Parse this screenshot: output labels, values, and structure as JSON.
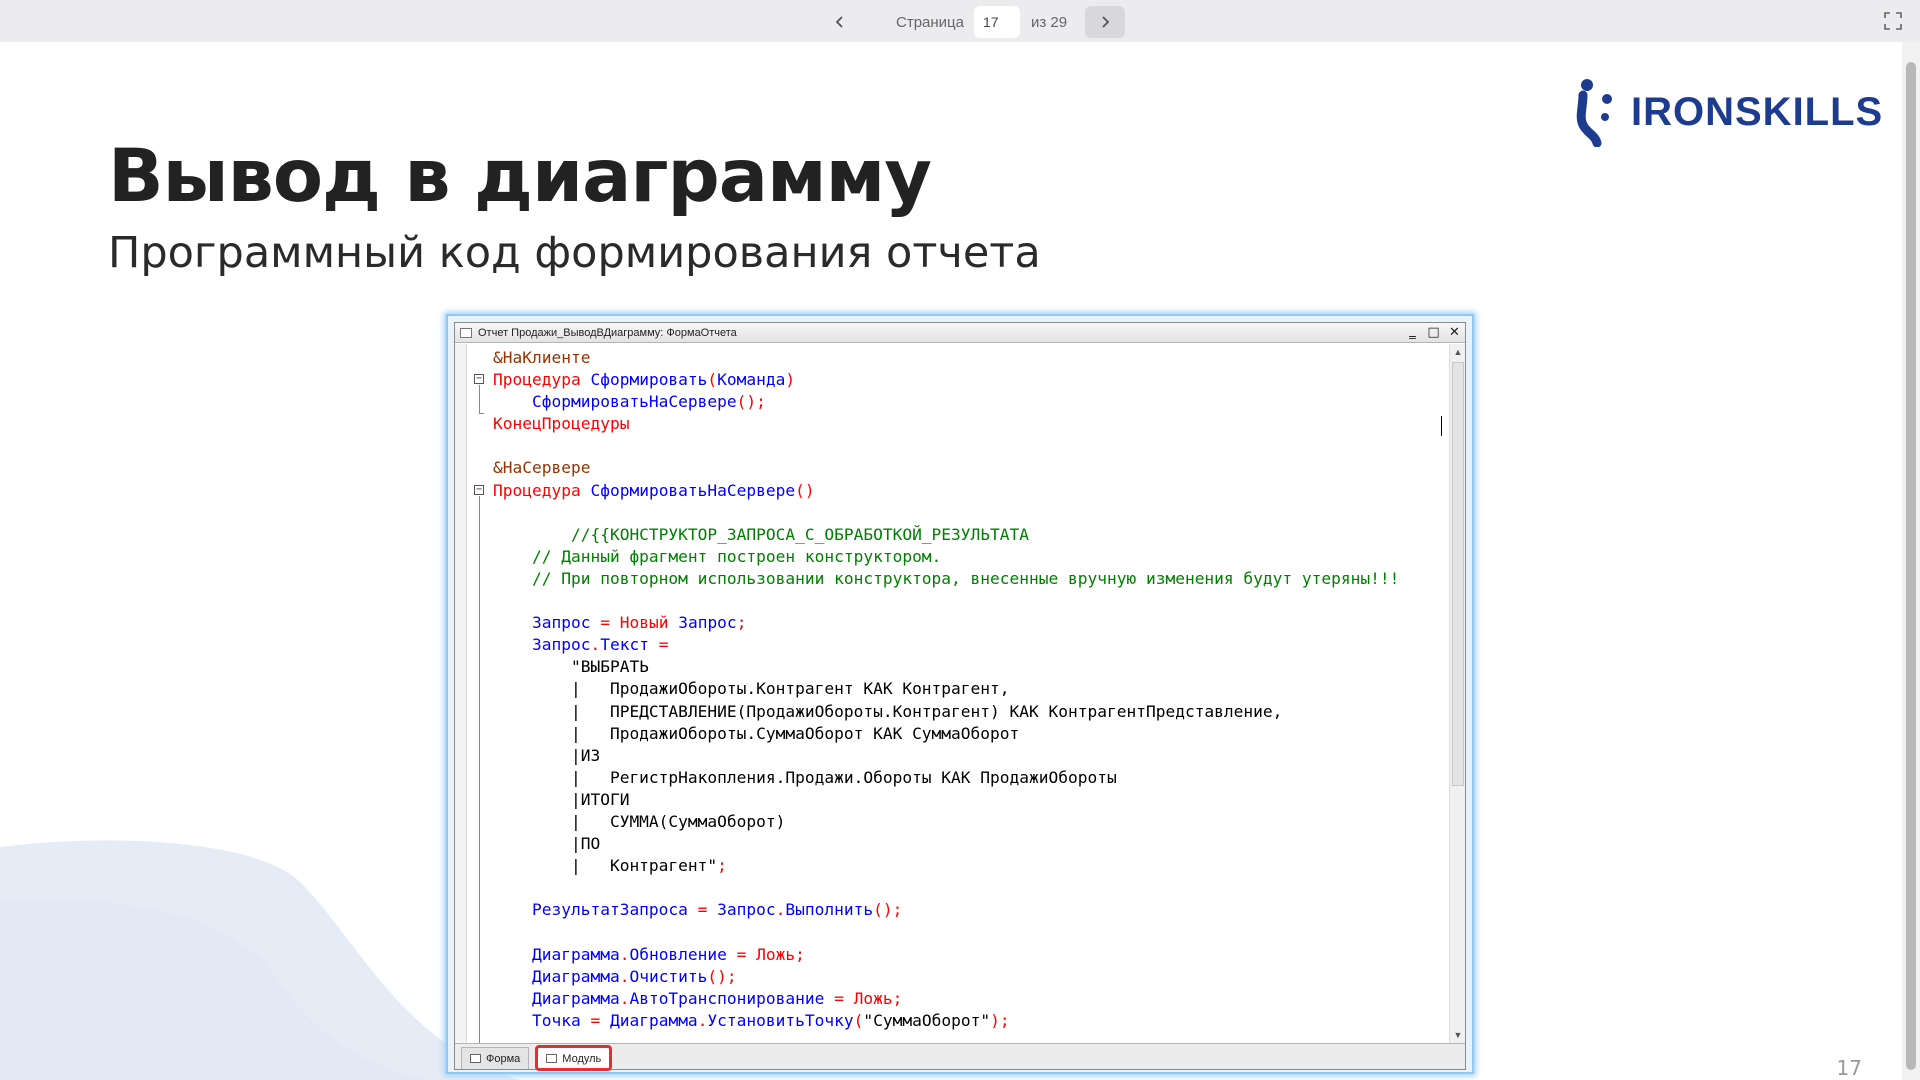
{
  "viewer": {
    "page_label": "Страница",
    "page_value": "17",
    "page_of": "из 29",
    "prev_icon": "chevron-left-icon",
    "next_icon": "chevron-right-icon",
    "fullscreen_icon": "fullscreen-icon"
  },
  "slide": {
    "brand": "IRONSKILLS",
    "brand_color": "#1e3c8f",
    "title": "Вывод в диаграмму",
    "subtitle": "Программный код формирования отчета",
    "page_number": "17"
  },
  "window": {
    "title": "Отчет Продажи_ВыводВДиаграмму: ФормаОтчета",
    "tabs": [
      {
        "label": "Форма",
        "active": false
      },
      {
        "label": "Модуль",
        "active": true
      }
    ]
  },
  "code_lines": [
    [
      [
        "pre",
        "&НаКлиенте"
      ]
    ],
    [
      [
        "kw",
        "Процедура "
      ],
      [
        "id",
        "Сформировать"
      ],
      [
        "op",
        "("
      ],
      [
        "id",
        "Команда"
      ],
      [
        "op",
        ")"
      ]
    ],
    [
      [
        "str",
        "    "
      ],
      [
        "id",
        "СформироватьНаСервере"
      ],
      [
        "op",
        "();"
      ]
    ],
    [
      [
        "kw",
        "КонецПроцедуры"
      ]
    ],
    [],
    [
      [
        "pre",
        "&НаСервере"
      ]
    ],
    [
      [
        "kw",
        "Процедура "
      ],
      [
        "id",
        "СформироватьНаСервере"
      ],
      [
        "op",
        "()"
      ]
    ],
    [],
    [
      [
        "cm",
        "        //{{КОНСТРУКТОР_ЗАПРОСА_С_ОБРАБОТКОЙ_РЕЗУЛЬТАТА"
      ]
    ],
    [
      [
        "cm",
        "    // Данный фрагмент построен конструктором."
      ]
    ],
    [
      [
        "cm",
        "    // При повторном использовании конструктора, внесенные вручную изменения будут утеряны!!!"
      ]
    ],
    [],
    [
      [
        "str",
        "    "
      ],
      [
        "id",
        "Запрос"
      ],
      [
        "op",
        " = "
      ],
      [
        "kw",
        "Новый "
      ],
      [
        "id",
        "Запрос"
      ],
      [
        "op",
        ";"
      ]
    ],
    [
      [
        "str",
        "    "
      ],
      [
        "id",
        "Запрос"
      ],
      [
        "op",
        "."
      ],
      [
        "id",
        "Текст"
      ],
      [
        "op",
        " ="
      ]
    ],
    [
      [
        "str",
        "        \"ВЫБРАТЬ"
      ]
    ],
    [
      [
        "str",
        "        |   ПродажиОбороты.Контрагент КАК Контрагент,"
      ]
    ],
    [
      [
        "str",
        "        |   ПРЕДСТАВЛЕНИЕ(ПродажиОбороты.Контрагент) КАК КонтрагентПредставление,"
      ]
    ],
    [
      [
        "str",
        "        |   ПродажиОбороты.СуммаОборот КАК СуммаОборот"
      ]
    ],
    [
      [
        "str",
        "        |ИЗ"
      ]
    ],
    [
      [
        "str",
        "        |   РегистрНакопления.Продажи.Обороты КАК ПродажиОбороты"
      ]
    ],
    [
      [
        "str",
        "        |ИТОГИ"
      ]
    ],
    [
      [
        "str",
        "        |   СУММА(СуммаОборот)"
      ]
    ],
    [
      [
        "str",
        "        |ПО"
      ]
    ],
    [
      [
        "str",
        "        |   Контрагент\""
      ],
      [
        "op",
        ";"
      ]
    ],
    [],
    [
      [
        "str",
        "    "
      ],
      [
        "id",
        "РезультатЗапроса"
      ],
      [
        "op",
        " = "
      ],
      [
        "id",
        "Запрос"
      ],
      [
        "op",
        "."
      ],
      [
        "id",
        "Выполнить"
      ],
      [
        "op",
        "();"
      ]
    ],
    [],
    [
      [
        "str",
        "    "
      ],
      [
        "id",
        "Диаграмма"
      ],
      [
        "op",
        "."
      ],
      [
        "id",
        "Обновление"
      ],
      [
        "op",
        " = "
      ],
      [
        "kw",
        "Ложь"
      ],
      [
        "op",
        ";"
      ]
    ],
    [
      [
        "str",
        "    "
      ],
      [
        "id",
        "Диаграмма"
      ],
      [
        "op",
        "."
      ],
      [
        "id",
        "Очистить"
      ],
      [
        "op",
        "();"
      ]
    ],
    [
      [
        "str",
        "    "
      ],
      [
        "id",
        "Диаграмма"
      ],
      [
        "op",
        "."
      ],
      [
        "id",
        "АвтоТранспонирование"
      ],
      [
        "op",
        " = "
      ],
      [
        "kw",
        "Ложь"
      ],
      [
        "op",
        ";"
      ]
    ],
    [
      [
        "str",
        "    "
      ],
      [
        "id",
        "Точка"
      ],
      [
        "op",
        " = "
      ],
      [
        "id",
        "Диаграмма"
      ],
      [
        "op",
        "."
      ],
      [
        "id",
        "УстановитьТочку"
      ],
      [
        "op",
        "("
      ],
      [
        "str",
        "\"СуммаОборот\""
      ],
      [
        "op",
        ");"
      ]
    ]
  ]
}
